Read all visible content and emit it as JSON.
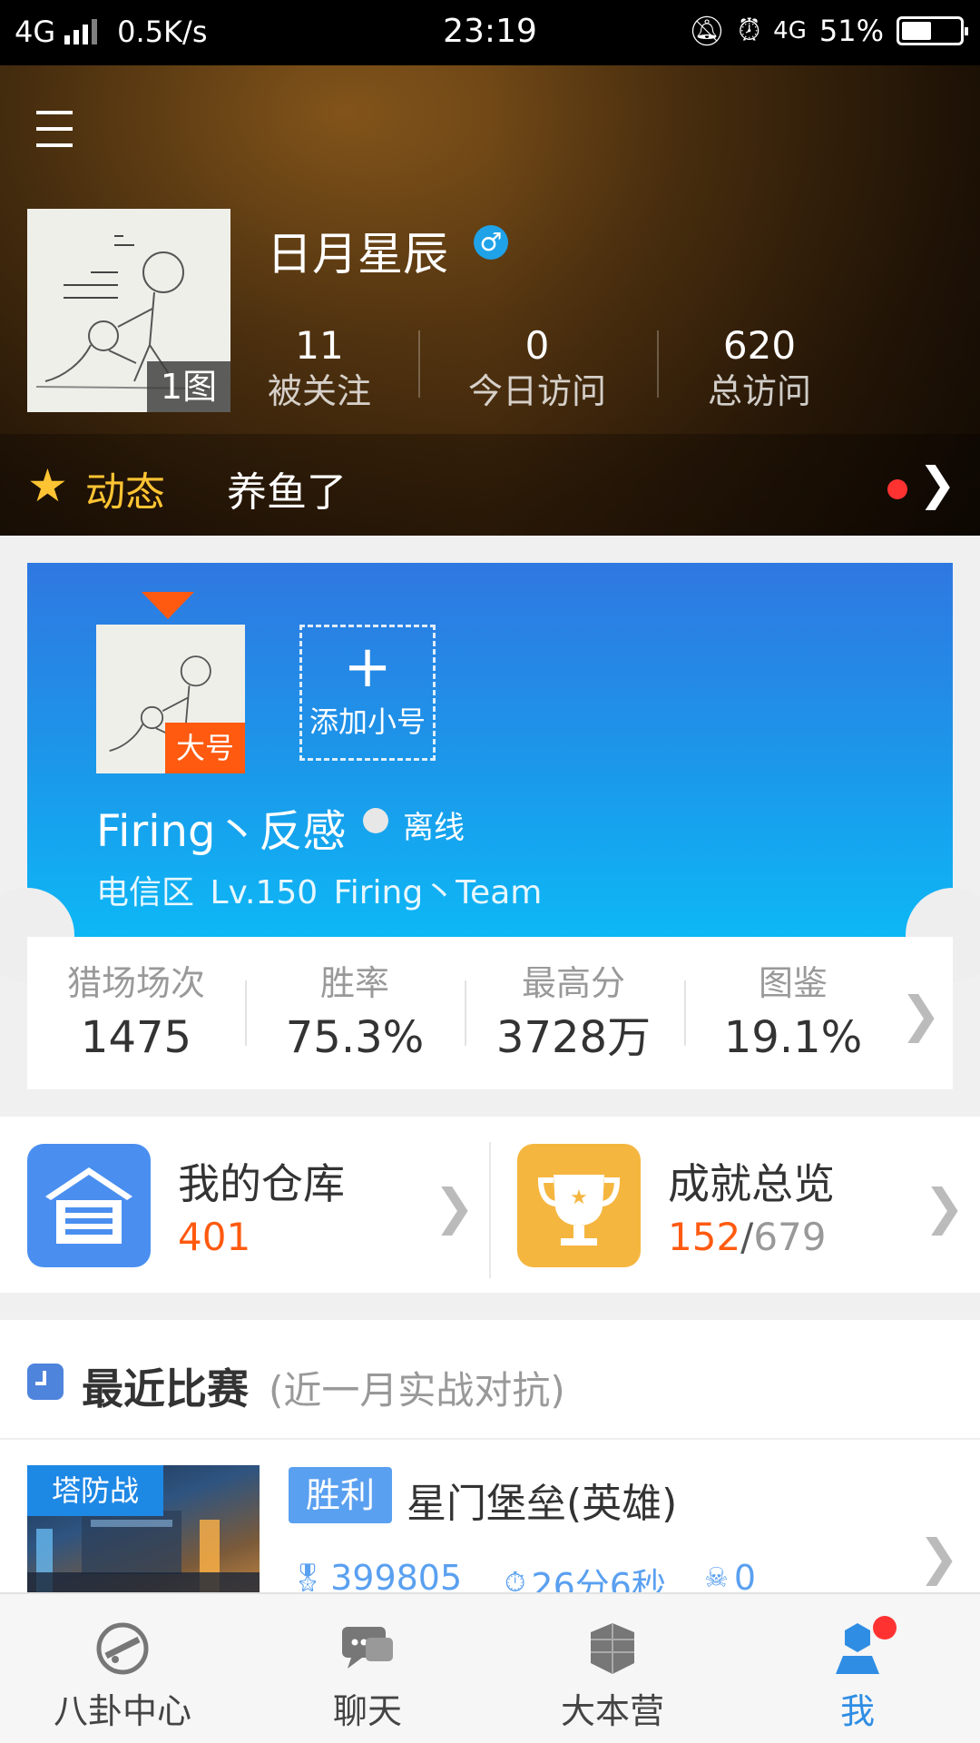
{
  "status_bar": {
    "network": "4G",
    "speed": "0.5K/s",
    "time": "23:19",
    "network_right": "4G",
    "battery": "51%",
    "battery_level": 0.51
  },
  "profile": {
    "name": "日月星辰",
    "gender_symbol": "♂",
    "image_count": "1图",
    "stats": [
      {
        "value": "11",
        "label": "被关注"
      },
      {
        "value": "0",
        "label": "今日访问"
      },
      {
        "value": "620",
        "label": "总访问"
      }
    ],
    "feed": {
      "tag": "动态",
      "text": "养鱼了"
    }
  },
  "account": {
    "main_badge": "大号",
    "add_plus": "+",
    "add_label": "添加小号",
    "name": "Firing丶反感",
    "status": "离线",
    "meta": "电信区   Lv.150   Firing丶Team"
  },
  "game_stats": [
    {
      "label": "猎场场次",
      "value": "1475"
    },
    {
      "label": "胜率",
      "value": "75.3%"
    },
    {
      "label": "最高分",
      "value": "3728万"
    },
    {
      "label": "图鉴",
      "value": "19.1%"
    }
  ],
  "quick": {
    "warehouse": {
      "title": "我的仓库",
      "value": "401"
    },
    "achievements": {
      "title": "成就总览",
      "value": "152",
      "sep": "/",
      "max": "679"
    }
  },
  "recent": {
    "title": "最近比赛",
    "subtitle": "(近一月实战对抗)",
    "match": {
      "type": "塔防战",
      "result": "胜利",
      "map": "星门堡垒(英雄)",
      "score": "399805",
      "duration": "26分6秒",
      "deaths": "0"
    }
  },
  "bottom_nav": [
    {
      "label": "八卦中心",
      "icon": "gossip-center-icon"
    },
    {
      "label": "聊天",
      "icon": "chat-icon"
    },
    {
      "label": "大本营",
      "icon": "base-camp-icon"
    },
    {
      "label": "我",
      "icon": "me-icon",
      "active": true
    }
  ],
  "colors": {
    "accent_blue": "#2f8de4",
    "accent_orange": "#ff5a10",
    "notice_red": "#ff3232",
    "gold": "#ffc433"
  }
}
